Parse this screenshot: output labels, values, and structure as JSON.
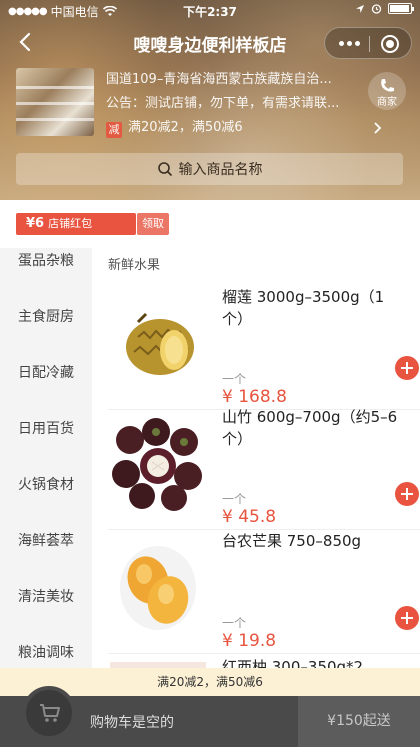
{
  "status_bar": {
    "carrier": "中国电信",
    "time": "下午2:37"
  },
  "navbar": {
    "title": "嗖嗖身边便利样板店"
  },
  "store": {
    "address": "国道109–青海省海西蒙古族藏族自治...",
    "notice": "公告：测试店铺，勿下单，有需求请联...",
    "promo_badge": "减",
    "promo_text": "满20减2，满50减6",
    "phone_label": "商家"
  },
  "search": {
    "placeholder": "输入商品名称"
  },
  "coupon": {
    "amount": "¥6",
    "label": "店铺红包",
    "claim_label": "领取"
  },
  "categories": [
    "蛋品杂粮",
    "主食厨房",
    "日配冷藏",
    "日用百货",
    "火锅食材",
    "海鲜荟萃",
    "清洁美妆",
    "粮油调味"
  ],
  "section_title": "新鲜水果",
  "products": [
    {
      "name": "榴莲 3000g–3500g（1个）",
      "unit": "一个",
      "price": "¥ 168.8",
      "image": "durian"
    },
    {
      "name": "山竹 600g–700g（约5–6个）",
      "unit": "一个",
      "price": "¥ 45.8",
      "image": "mangosteen"
    },
    {
      "name": "台农芒果 750–850g",
      "unit": "一个",
      "price": "¥ 19.8",
      "image": "mango"
    },
    {
      "name": "红西柚 300–350g*2",
      "unit": "",
      "price": "",
      "image": "grapefruit"
    }
  ],
  "promo_strip": "满20减2，满50减6",
  "cart": {
    "empty_text": "购物车是空的",
    "min_order": "¥150起送"
  },
  "colors": {
    "accent": "#e8543f",
    "cart_bar": "#4a4a4a",
    "promo_strip_bg": "#fcf1d5"
  }
}
